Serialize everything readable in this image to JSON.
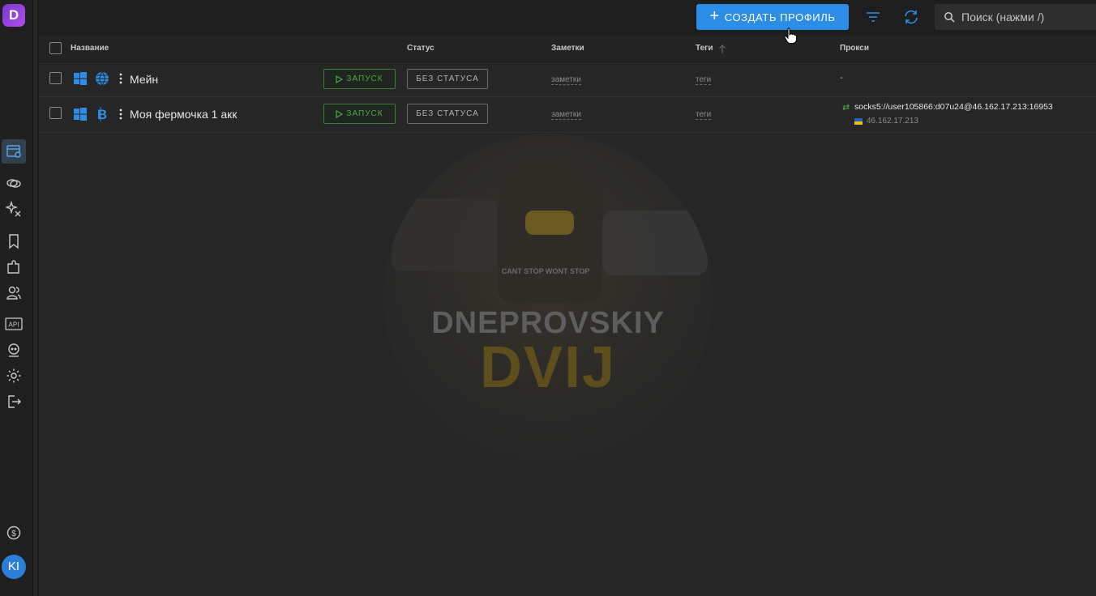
{
  "app": {
    "logo_letter": "D"
  },
  "topbar": {
    "create_label": "СОЗДАТЬ ПРОФИЛЬ",
    "search_placeholder": "Поиск (нажми /)"
  },
  "table": {
    "headers": {
      "name": "Название",
      "status": "Статус",
      "notes": "Заметки",
      "tags": "Теги",
      "proxy": "Прокси"
    },
    "rows": [
      {
        "name": "Мейн",
        "os_icon": "windows-icon",
        "browser_icon": "globe-icon",
        "start_label": "ЗАПУСК",
        "status_label": "БЕЗ СТАТУСА",
        "notes": "заметки",
        "tags": "теги",
        "proxy": "-"
      },
      {
        "name": "Моя фермочка 1 акк",
        "os_icon": "windows-icon",
        "browser_icon": "bitcoin-icon",
        "start_label": "ЗАПУСК",
        "status_label": "БЕЗ СТАТУСА",
        "notes": "заметки",
        "tags": "теги",
        "proxy": "socks5://user105866:d07u24@46.162.17.213:16953",
        "proxy_ip": "46.162.17.213"
      }
    ]
  },
  "watermark": {
    "shirt_text": "CANT STOP WONT STOP",
    "line1": "DNEPROVSKIY",
    "line2": "DVIJ"
  },
  "user": {
    "initials": "KI"
  },
  "colors": {
    "accent": "#2c8de6",
    "start_green": "#4fa64a",
    "logo": "#8a3fe0"
  }
}
